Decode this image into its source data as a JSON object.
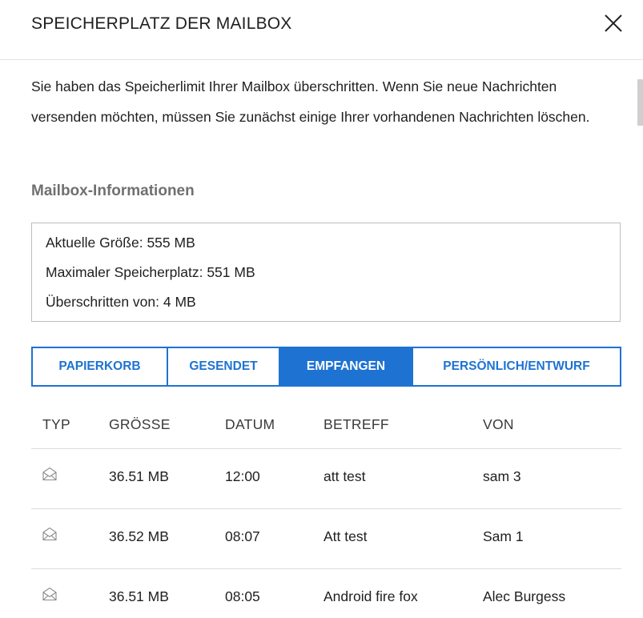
{
  "dialog": {
    "title": "SPEICHERPLATZ DER MAILBOX",
    "close_icon": "close-icon"
  },
  "intro_text": "Sie haben das Speicherlimit Ihrer Mailbox überschritten. Wenn Sie neue Nachrichten versenden möchten, müssen Sie zunächst einige Ihrer vorhandenen Nachrichten löschen.",
  "mailbox_info": {
    "heading": "Mailbox-Informationen",
    "lines": [
      "Aktuelle Größe: 555 MB",
      "Maximaler Speicherplatz: 551 MB",
      "Überschritten von: 4 MB"
    ]
  },
  "tabs": [
    {
      "label": "PAPIERKORB",
      "active": false
    },
    {
      "label": "GESENDET",
      "active": false
    },
    {
      "label": "EMPFANGEN",
      "active": true
    },
    {
      "label": "PERSÖNLICH/ENTWURF",
      "active": false
    }
  ],
  "table": {
    "columns": [
      "TYP",
      "GRÖSSE",
      "DATUM",
      "BETREFF",
      "VON"
    ],
    "rows": [
      {
        "type_icon": "envelope-icon",
        "size": "36.51 MB",
        "date": "12:00",
        "subject": "att test",
        "from": "sam 3"
      },
      {
        "type_icon": "envelope-icon",
        "size": "36.52 MB",
        "date": "08:07",
        "subject": "Att test",
        "from": "Sam 1"
      },
      {
        "type_icon": "envelope-icon",
        "size": "36.51 MB",
        "date": "08:05",
        "subject": "Android fire fox",
        "from": "Alec Burgess"
      }
    ]
  },
  "colors": {
    "accent": "#1e73d2",
    "heading_gray": "#707070",
    "border_gray": "#bdbdbd"
  }
}
